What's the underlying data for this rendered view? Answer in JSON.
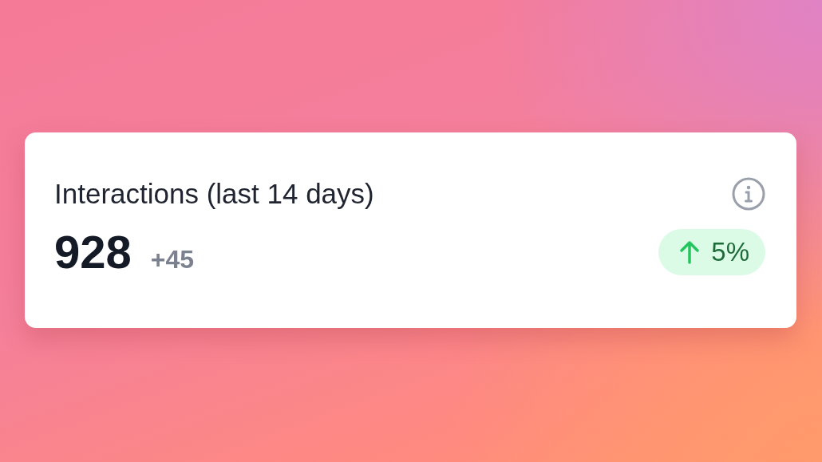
{
  "card": {
    "title": "Interactions (last 14 days)",
    "value": "928",
    "delta": "+45",
    "badge": {
      "rising": true,
      "label": "5%"
    }
  }
}
